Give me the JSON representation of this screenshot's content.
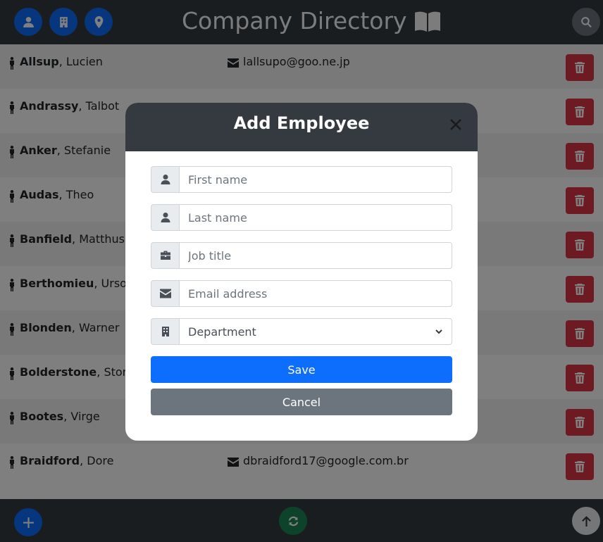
{
  "header": {
    "title": "Company Directory",
    "buttons": [
      "person-icon",
      "building-icon",
      "location-icon"
    ],
    "search_icon": "search-icon",
    "title_icon": "book-open-icon"
  },
  "employees": [
    {
      "last": "Allsup",
      "first": "Lucien",
      "email": "lallsupo@goo.ne.jp"
    },
    {
      "last": "Andrassy",
      "first": "Talbot",
      "email": ""
    },
    {
      "last": "Anker",
      "first": "Stefanie",
      "email": ""
    },
    {
      "last": "Audas",
      "first": "Theo",
      "email": ""
    },
    {
      "last": "Banfield",
      "first": "Matthus",
      "email": ""
    },
    {
      "last": "Berthomieu",
      "first": "Urso",
      "email": ""
    },
    {
      "last": "Blonden",
      "first": "Warner",
      "email": ""
    },
    {
      "last": "Bolderstone",
      "first": "Ston",
      "email": ""
    },
    {
      "last": "Bootes",
      "first": "Virge",
      "email": ""
    },
    {
      "last": "Braidford",
      "first": "Dore",
      "email": "dbraidford17@google.com.br"
    }
  ],
  "modal": {
    "title": "Add Employee",
    "fields": {
      "first_name": "First name",
      "last_name": "Last name",
      "job_title": "Job title",
      "email": "Email address",
      "department": "Department"
    },
    "save_label": "Save",
    "cancel_label": "Cancel"
  },
  "footer": {
    "add_icon": "plus-icon",
    "refresh_icon": "refresh-icon",
    "top_icon": "arrow-up-icon"
  },
  "colors": {
    "header_bg": "#343a40",
    "primary": "#0d6efd",
    "danger": "#dc3545",
    "secondary": "#6c757d",
    "success": "#198754"
  }
}
